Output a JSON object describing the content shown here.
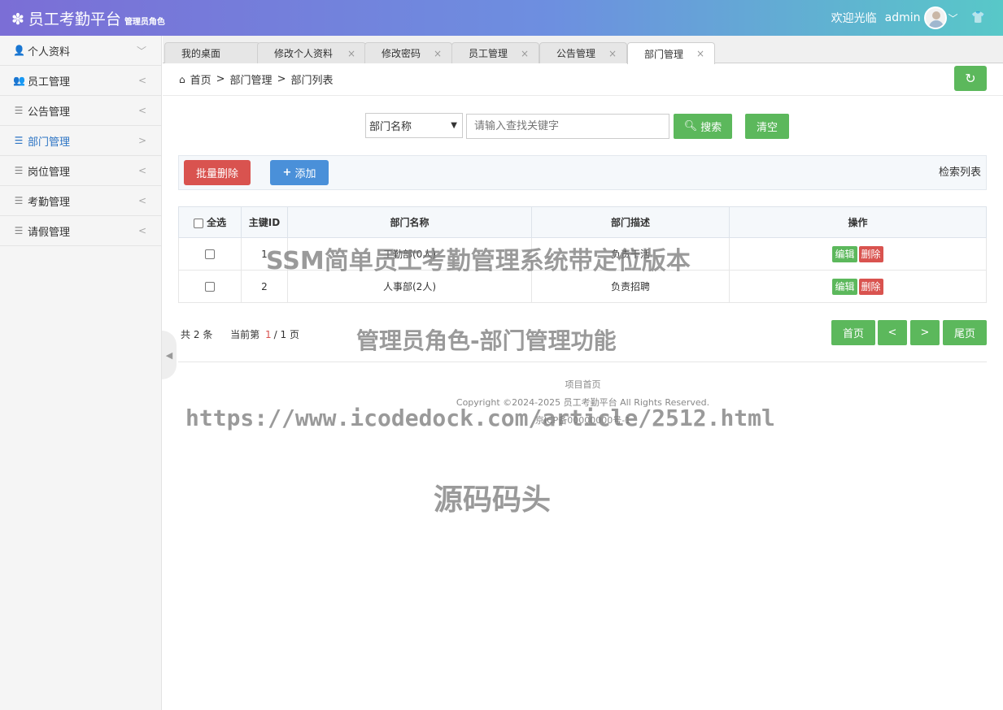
{
  "header": {
    "logo_icon": "gear-icon",
    "title": "员工考勤平台",
    "subtitle": "管理员角色",
    "welcome": "欢迎光临",
    "username": "admin"
  },
  "sidebar": {
    "items": [
      {
        "label": "个人资料",
        "icon": "user-icon",
        "arrow": "﹀"
      },
      {
        "label": "员工管理",
        "icon": "users-icon",
        "arrow": "<"
      },
      {
        "label": "公告管理",
        "icon": "list-icon",
        "arrow": "<"
      },
      {
        "label": "部门管理",
        "icon": "list-icon",
        "arrow": ">",
        "active": true
      },
      {
        "label": "岗位管理",
        "icon": "list-icon",
        "arrow": "<"
      },
      {
        "label": "考勤管理",
        "icon": "list-icon",
        "arrow": "<"
      },
      {
        "label": "请假管理",
        "icon": "list-icon",
        "arrow": "<"
      }
    ]
  },
  "tabs": [
    {
      "label": "我的桌面"
    },
    {
      "label": "修改个人资料"
    },
    {
      "label": "修改密码"
    },
    {
      "label": "员工管理"
    },
    {
      "label": "公告管理"
    },
    {
      "label": "部门管理",
      "active": true
    }
  ],
  "breadcrumb": {
    "home": "首页",
    "sep": ">",
    "level1": "部门管理",
    "level2": "部门列表"
  },
  "search": {
    "field_selected": "部门名称",
    "placeholder": "请输入查找关键字",
    "search_label": "搜索",
    "clear_label": "清空"
  },
  "toolbar": {
    "batch_delete": "批量删除",
    "add": "添加",
    "title": "检索列表"
  },
  "table": {
    "headers": {
      "select_all": "全选",
      "id": "主键ID",
      "name": "部门名称",
      "desc": "部门描述",
      "ops": "操作"
    },
    "rows": [
      {
        "id": "1",
        "name": "工勤部(0人)",
        "desc": "负责干活"
      },
      {
        "id": "2",
        "name": "人事部(2人)",
        "desc": "负责招聘"
      }
    ],
    "edit_label": "编辑",
    "delete_label": "删除"
  },
  "pager": {
    "total_prefix": "共",
    "total": "2",
    "total_suffix": "条",
    "current_prefix": "当前第",
    "current": "1",
    "pages": "/ 1 页",
    "first": "首页",
    "prev": "<",
    "next": ">",
    "last": "尾页"
  },
  "footer": {
    "home_link": "项目首页",
    "copyright": "Copyright ©2024-2025 员工考勤平台 All Rights Reserved.",
    "icp": "京ICP备00000000号-1"
  },
  "watermarks": {
    "title": "SSM简单员工考勤管理系统带定位版本",
    "subtitle": "管理员角色-部门管理功能",
    "url": "https://www.icodedock.com/article/2512.html",
    "brand": "源码码头"
  }
}
